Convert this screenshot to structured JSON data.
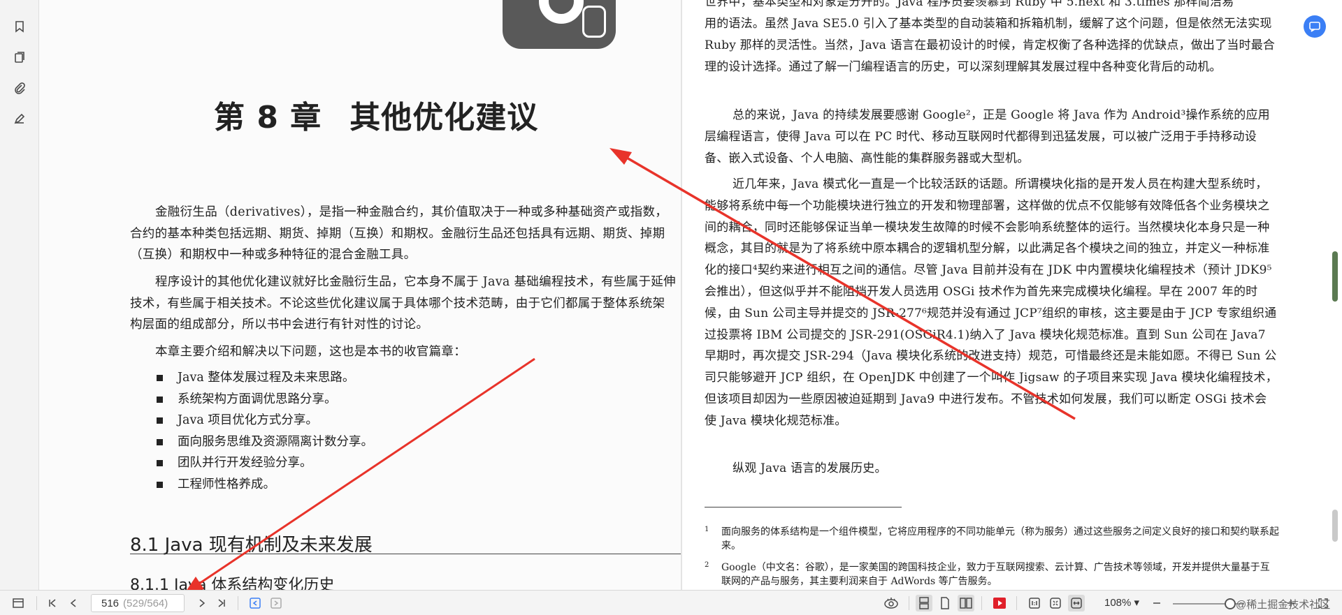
{
  "sidebar": {
    "icons": [
      "bookmark-icon",
      "pages-icon",
      "attachment-icon",
      "sign-icon"
    ]
  },
  "left_page": {
    "chapter_number": "第 8 章",
    "chapter_name": "其他优化建议",
    "paragraphs": [
      "金融衍生品（derivatives），是指一种金融合约，其价值取决于一种或多种基础资产或指数，合约的基本种类包括远期、期货、掉期（互换）和期权。金融衍生品还包括具有远期、期货、掉期（互换）和期权中一种或多种特征的混合金融工具。",
      "程序设计的其他优化建议就好比金融衍生品，它本身不属于 Java 基础编程技术，有些属于延伸技术，有些属于相关技术。不论这些优化建议属于具体哪个技术范畴，由于它们都属于整体系统架构层面的组成部分，所以书中会进行有针对性的讨论。",
      "本章主要介绍和解决以下问题，这也是本书的收官篇章："
    ],
    "bullets": [
      "Java 整体发展过程及未来思路。",
      "系统架构方面调优思路分享。",
      "Java 项目优化方式分享。",
      "面向服务思维及资源隔离计数分享。",
      "团队并行开发经验分享。",
      "工程师性格养成。"
    ],
    "section_title": "8.1   Java 现有机制及未来发展",
    "subsection_title": "8.1.1   Java 体系结构变化历史"
  },
  "right_page": {
    "top_partial": "世界中，基本类型和对象是分开的。Java 程序员要羡慕到 Ruby 中 5.next 和 3.times 那样简洁易",
    "paragraphs": [
      {
        "text": "用的语法。虽然 Java SE5.0 引入了基本类型的自动装箱和拆箱机制，缓解了这个问题，但是依然无法实现 Ruby 那样的灵活性。当然，Java 语言在最初设计的时候，肯定权衡了各种选择的优缺点，做出了当时最合理的设计选择。通过了解一门编程语言的历史，可以深刻理解其发展过程中各种变化背后的动机。",
        "indent": false
      },
      {
        "text": "总的来说，Java 的持续发展要感谢 Google²，正是 Google 将 Java 作为 Android³操作系统的应用层编程语言，使得 Java 可以在 PC 时代、移动互联网时代都得到迅猛发展，可以被广泛用于手持移动设备、嵌入式设备、个人电脑、高性能的集群服务器或大型机。",
        "indent": true
      },
      {
        "text": "近几年来，Java 模式化一直是一个比较活跃的话题。所谓模块化指的是开发人员在构建大型系统时，能够将系统中每一个功能模块进行独立的开发和物理部署，这样做的优点不仅能够有效降低各个业务模块之间的耦合，同时还能够保证当单一模块发生故障的时候不会影响系统整体的运行。当然模块化本身只是一种概念，其目的就是为了将系统中原本耦合的逻辑机型分解，以此满足各个模块之间的独立，并定义一种标准化的接口⁴契约来进行相互之间的通信。尽管 Java 目前并没有在 JDK 中内置模块化编程技术（预计 JDK9⁵会推出），但这似乎并不能阻挡开发人员选用 OSGi 技术作为首先来完成模块化编程。早在 2007 年的时候，由 Sun 公司主导并提交的 JSR-277⁶规范并没有通过 JCP⁷组织的审核，这主要是由于 JCP 专家组织通过投票将 IBM 公司提交的 JSR-291(OSGiR4.1)纳入了 Java 模块化规范标准。直到 Sun 公司在 Java7 早期时，再次提交 JSR-294（Java 模块化系统的改进支持）规范，可惜最终还是未能如愿。不得已 Sun 公司只能够避开 JCP 组织，在 OpenJDK 中创建了一个叫作 Jigsaw 的子项目来实现 Java 模块化编程技术，但该项目却因为一些原因被迫延期到 Java9 中进行发布。不管技术如何发展，我们可以断定 OSGi 技术会使 Java 模块化规范标准。",
        "indent": true
      },
      {
        "text": "纵观 Java 语言的发展历史。",
        "indent": true
      }
    ],
    "footnotes": [
      {
        "num": "1",
        "text": "面向服务的体系结构是一个组件模型，它将应用程序的不同功能单元（称为服务）通过这些服务之间定义良好的接口和契约联系起来。"
      },
      {
        "num": "2",
        "text": "Google（中文名：谷歌），是一家美国的跨国科技企业，致力于互联网搜索、云计算、广告技术等领域，开发并提供大量基于互联网的产品与服务，其主要利润来自于 AdWords 等广告服务。"
      }
    ]
  },
  "toolbar": {
    "page_current": "516",
    "page_total": "(529/564)",
    "zoom": "108%",
    "watermark": "@稀土掘金技术社区"
  },
  "colors": {
    "arrow": "#e8332a",
    "accent": "#3b7ff5",
    "stop_button": "#e0202a"
  }
}
